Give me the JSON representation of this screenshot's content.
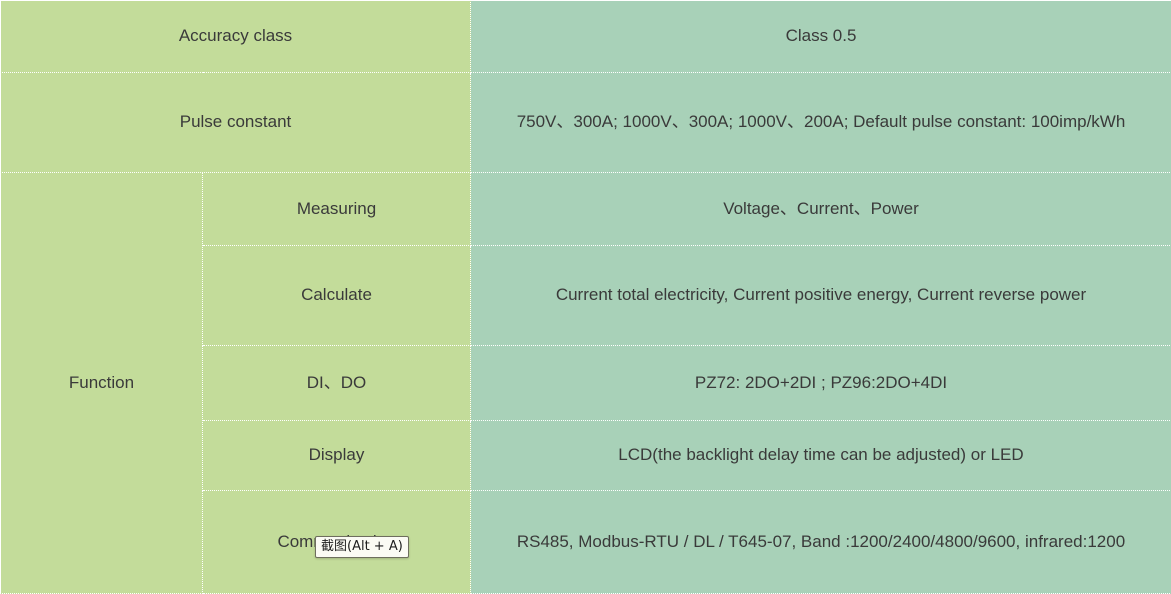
{
  "table": {
    "rows": [
      {
        "group": "Accuracy class",
        "group_span": 2,
        "sub": null,
        "value": "Class 0.5"
      },
      {
        "group": "Pulse constant",
        "group_span": 2,
        "sub": null,
        "value": "750V、300A; 1000V、300A; 1000V、200A; Default pulse constant: 100imp/kWh"
      },
      {
        "group": "Function",
        "group_span": 1,
        "sub": "Measuring",
        "value": "Voltage、Current、Power"
      },
      {
        "group": null,
        "sub": "Calculate",
        "value": "Current total electricity, Current positive energy, Current reverse power"
      },
      {
        "group": null,
        "sub": "DI、DO",
        "value": "PZ72: 2DO+2DI ; PZ96:2DO+4DI"
      },
      {
        "group": null,
        "sub": "Display",
        "value": "LCD(the backlight delay time can be adjusted) or LED"
      },
      {
        "group": null,
        "sub": "Communication",
        "value": "RS485, Modbus-RTU / DL / T645-07, Band :1200/2400/4800/9600, infrared:1200"
      }
    ]
  },
  "tooltip": {
    "text": "截图(Alt + A)"
  },
  "colors": {
    "label_bg": "#c3dc9a",
    "value_bg": "#a8d1b8",
    "text": "#3a3a3a",
    "grid": "#ffffff",
    "tooltip_bg": "#fbfbf4",
    "tooltip_border": "#6e6e5e"
  }
}
